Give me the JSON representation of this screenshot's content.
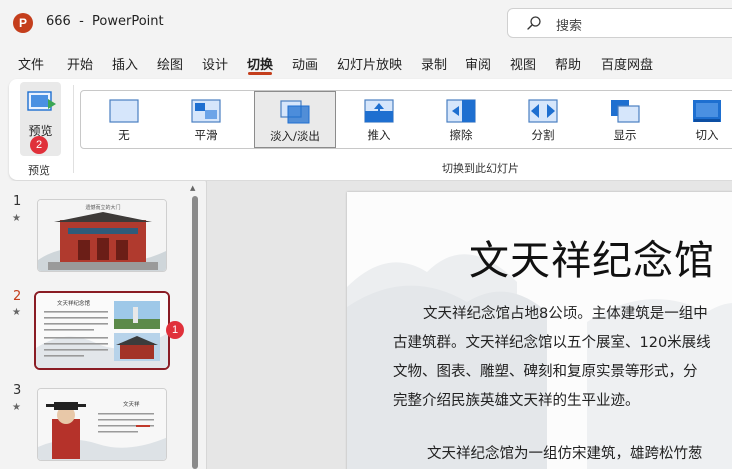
{
  "app": {
    "logo_letter": "P",
    "title": "666  -  PowerPoint",
    "search_placeholder": "搜索"
  },
  "menu": {
    "tabs": [
      "文件",
      "开始",
      "插入",
      "绘图",
      "设计",
      "切换",
      "动画",
      "幻灯片放映",
      "录制",
      "审阅",
      "视图",
      "帮助",
      "百度网盘"
    ],
    "active_index": 5
  },
  "ribbon": {
    "preview_button": "预览",
    "preview_group_label": "预览",
    "preview_badge": "2",
    "transitions": [
      "无",
      "平滑",
      "淡入/淡出",
      "推入",
      "擦除",
      "分割",
      "显示",
      "切入"
    ],
    "selected_transition": "淡入/淡出",
    "transitions_group_label": "切换到此幻灯片"
  },
  "slides_panel": {
    "slides": [
      {
        "number": "1",
        "star": "★",
        "title": "遗憾而立的大门"
      },
      {
        "number": "2",
        "star": "★",
        "title": "文天祥纪念馆",
        "badge": "1"
      },
      {
        "number": "3",
        "star": "★",
        "title": "文天祥"
      }
    ],
    "current_slide": "2"
  },
  "slide": {
    "title": "文天祥纪念馆",
    "paragraphs": [
      "文天祥纪念馆占地8公顷。主体建筑是一组中",
      "古建筑群。文天祥纪念馆以五个展室、120米展线",
      "文物、图表、雕塑、碑刻和复原实景等形式，分",
      "完整介绍民族英雄文天祥的生平业迹。",
      "文天祥纪念馆为一组仿宋建筑，雄跨松竹葱"
    ]
  },
  "colors": {
    "accent": "#c43e1c",
    "selected_border": "#8a1c24",
    "badge": "#e0303a",
    "icon_blue": "#1e6fd0"
  }
}
